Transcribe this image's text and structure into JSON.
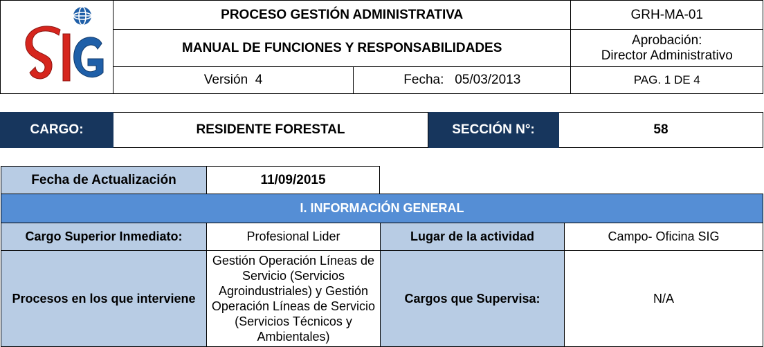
{
  "header": {
    "process_title": "PROCESO GESTIÓN ADMINISTRATIVA",
    "code": "GRH-MA-01",
    "manual_title": "MANUAL DE FUNCIONES Y RESPONSABILIDADES",
    "approval_label": "Aprobación:",
    "approval_value": "Director Administrativo",
    "version_label": "Versión",
    "version_value": "4",
    "date_label": "Fecha:",
    "date_value": "05/03/2013",
    "page": "PAG. 1 DE 4",
    "logo_letters": "SIG",
    "colors": {
      "logo_red": "#d6261e",
      "logo_blue": "#1f5fa8"
    }
  },
  "cargo": {
    "cargo_label": "CARGO:",
    "cargo_value": "RESIDENTE FORESTAL",
    "section_label": "SECCIÓN N°:",
    "section_value": "58",
    "colors": {
      "navy": "#17365d"
    }
  },
  "update": {
    "label": "Fecha de Actualización",
    "value": "11/09/2015"
  },
  "general_info": {
    "heading": "I. INFORMACIÓN GENERAL",
    "superior_label": "Cargo Superior Inmediato:",
    "superior_value": "Profesional Lider",
    "place_label": "Lugar de la actividad",
    "place_value": "Campo- Oficina SIG",
    "processes_label": "Procesos en los que interviene",
    "processes_value": "Gestión Operación Líneas de Servicio (Servicios Agroindustriales) y Gestión Operación Líneas de Servicio (Servicios Técnicos y Ambientales)",
    "supervises_label": "Cargos que  Supervisa:",
    "supervises_value": "N/A",
    "colors": {
      "heading_bg": "#558ed5",
      "label_bg": "#b8cce4"
    }
  }
}
